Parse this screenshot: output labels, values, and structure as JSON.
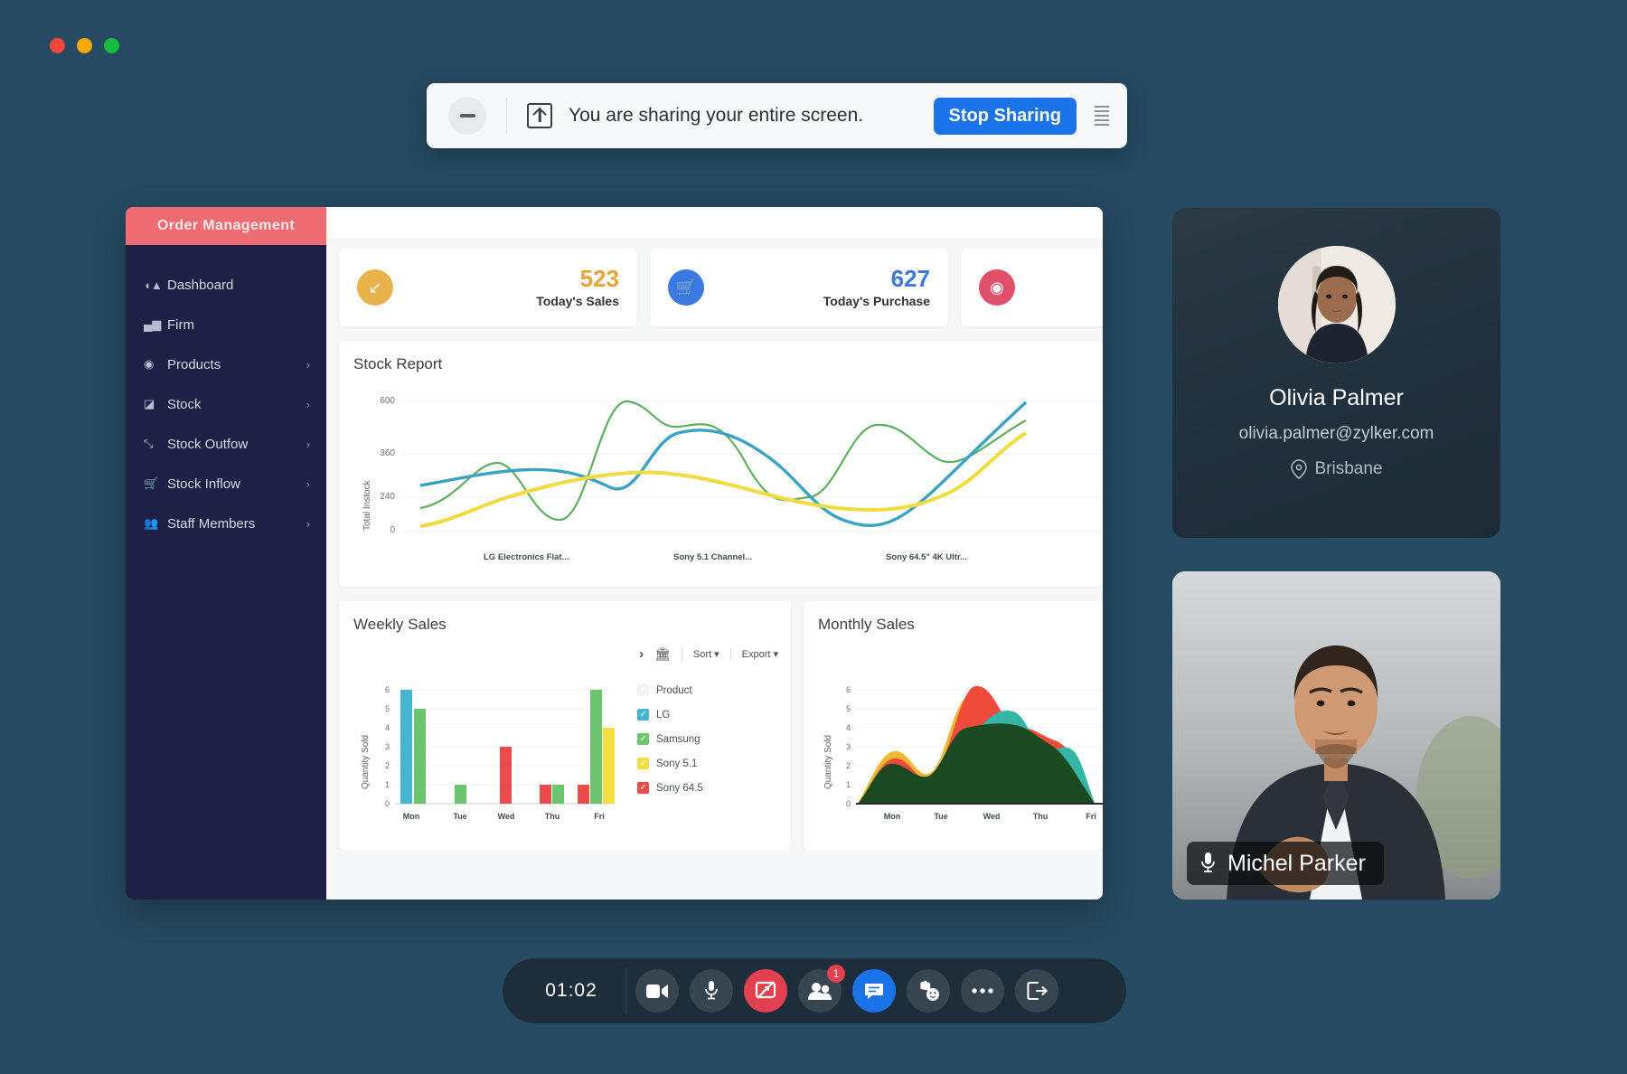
{
  "window_controls": {
    "close": "close",
    "minimize": "minimize",
    "zoom": "zoom"
  },
  "share_banner": {
    "minimize_label": "minimize-sharing-bar",
    "screen_icon": "screen-share-icon",
    "message": "You are sharing your entire screen.",
    "stop_label": "Stop Sharing",
    "menu_label": "more-options"
  },
  "dashboard": {
    "brand": "Order Management",
    "nav": [
      {
        "label": "Dashboard",
        "icon": "dashboard-icon",
        "chevron": ""
      },
      {
        "label": "Firm",
        "icon": "bar-chart-icon",
        "chevron": ""
      },
      {
        "label": "Products",
        "icon": "box-icon",
        "chevron": "›"
      },
      {
        "label": "Stock",
        "icon": "layers-icon",
        "chevron": "›"
      },
      {
        "label": "Stock Outfow",
        "icon": "trend-down-icon",
        "chevron": "›"
      },
      {
        "label": "Stock Inflow",
        "icon": "cart-icon",
        "chevron": "›"
      },
      {
        "label": "Staff Members",
        "icon": "users-icon",
        "chevron": "›"
      }
    ],
    "kpis": [
      {
        "value": "523",
        "label": "Today's Sales",
        "icon": "trend-icon",
        "color": "#e8b34a",
        "value_color": "#e8a23a"
      },
      {
        "value": "627",
        "label": "Today's Purchase",
        "icon": "cart-icon",
        "color": "#3b79e0",
        "value_color": "#3b79e0"
      },
      {
        "value": "",
        "label": "",
        "icon": "box-icon",
        "color": "#e0506a",
        "value_color": "#e0506a"
      }
    ],
    "stock_report": {
      "title": "Stock Report"
    },
    "weekly": {
      "title": "Weekly Sales",
      "tools": {
        "expand": "›",
        "chart_icon": "chart-icon",
        "sort": "Sort ▾",
        "export": "Export ▾"
      },
      "legend": [
        {
          "label": "Product",
          "color": "#f2f3f4"
        },
        {
          "label": "LG",
          "color": "#45b5d0"
        },
        {
          "label": "Samsung",
          "color": "#6cc46f"
        },
        {
          "label": "Sony 5.1",
          "color": "#f4dd41"
        },
        {
          "label": "Sony 64.5",
          "color": "#eb4b4b"
        }
      ]
    },
    "monthly": {
      "title": "Monthly Sales"
    }
  },
  "participants": [
    {
      "name": "Olivia Palmer",
      "email": "olivia.palmer@zylker.com",
      "location": "Brisbane",
      "location_icon": "map-pin-icon",
      "avatar": "avatar"
    },
    {
      "name": "Michel Parker",
      "mic_icon": "microphone-icon"
    }
  ],
  "toolbar": {
    "timer": "01:02",
    "buttons": [
      {
        "name": "video-button",
        "icon": "video-camera-icon",
        "state": "default",
        "badge": ""
      },
      {
        "name": "mic-button",
        "icon": "microphone-icon",
        "state": "default",
        "badge": ""
      },
      {
        "name": "screen-share-button",
        "icon": "screen-share-off-icon",
        "state": "active-red",
        "badge": ""
      },
      {
        "name": "participants-button",
        "icon": "people-icon",
        "state": "default",
        "badge": "1"
      },
      {
        "name": "chat-button",
        "icon": "chat-bubble-icon",
        "state": "active-blue",
        "badge": ""
      },
      {
        "name": "raise-hand-button",
        "icon": "raised-hand-icon",
        "state": "default",
        "badge": ""
      },
      {
        "name": "more-button",
        "icon": "ellipsis-icon",
        "state": "default",
        "badge": ""
      },
      {
        "name": "leave-button",
        "icon": "exit-icon",
        "state": "default",
        "badge": ""
      }
    ]
  },
  "chart_data": [
    {
      "type": "line",
      "title": "Stock Report",
      "xlabel": "",
      "ylabel": "Total Instock",
      "categories": [
        "LG Electronics Flat...",
        "Sony 5.1 Channel...",
        "Sony 64.5\" 4K Ultr..."
      ],
      "yticks": [
        0,
        240,
        360,
        600
      ],
      "ylim": [
        0,
        600
      ],
      "grid": true,
      "series": [
        {
          "name": "green",
          "color": "#5faf5f",
          "values": [
            215,
            300,
            560,
            230,
            520,
            440,
            390,
            500,
            330,
            500,
            420,
            520
          ]
        },
        {
          "name": "blue",
          "color": "#3aa3c4",
          "values": [
            275,
            300,
            310,
            295,
            250,
            360,
            375,
            350,
            300,
            230,
            235,
            560
          ]
        },
        {
          "name": "yellow",
          "color": "#f0dc3e",
          "values": [
            165,
            230,
            265,
            280,
            290,
            300,
            300,
            290,
            270,
            265,
            275,
            430
          ]
        }
      ]
    },
    {
      "type": "bar",
      "title": "Weekly Sales",
      "xlabel": "",
      "ylabel": "Quantity Sold",
      "categories": [
        "Mon",
        "Tue",
        "Wed",
        "Thu",
        "Fri"
      ],
      "yticks": [
        0,
        1,
        2,
        3,
        4,
        5,
        6
      ],
      "ylim": [
        0,
        6
      ],
      "grid": true,
      "series": [
        {
          "name": "LG",
          "color": "#45b5d0",
          "values": [
            6,
            0,
            0,
            0,
            0
          ]
        },
        {
          "name": "Samsung",
          "color": "#6cc46f",
          "values": [
            5,
            1,
            0,
            1,
            6
          ]
        },
        {
          "name": "Sony 5.1",
          "color": "#f4dd41",
          "values": [
            0,
            0,
            0,
            0,
            4
          ]
        },
        {
          "name": "Sony 64.5",
          "color": "#eb4b4b",
          "values": [
            0,
            0,
            3,
            1,
            1
          ]
        }
      ]
    },
    {
      "type": "area",
      "title": "Monthly Sales",
      "xlabel": "",
      "ylabel": "Quantity Sold",
      "categories": [
        "Mon",
        "Tue",
        "Wed",
        "Thu",
        "Fri"
      ],
      "yticks": [
        0,
        1,
        2,
        3,
        4,
        5,
        6
      ],
      "ylim": [
        0,
        6
      ],
      "grid": true,
      "stacked": true,
      "series": [
        {
          "name": "dark-green",
          "color": "#1b4a22",
          "values": [
            0.2,
            1.7,
            1.3,
            3.0,
            3.3,
            2.8,
            2.3,
            1.2,
            1.7,
            0.1
          ]
        },
        {
          "name": "teal",
          "color": "#35b5a6",
          "values": [
            0.0,
            0.0,
            0.0,
            0.0,
            1.3,
            0.6,
            0.4,
            0.9,
            0.0,
            0.0
          ]
        },
        {
          "name": "green",
          "color": "#4caf50",
          "values": [
            0.0,
            0.0,
            0.0,
            0.0,
            0.4,
            0.3,
            0.9,
            0.4,
            0.0,
            0.0
          ]
        },
        {
          "name": "red",
          "color": "#ee4b3c",
          "values": [
            0.3,
            1.2,
            0.4,
            2.7,
            0.6,
            0.9,
            0.4,
            0.2,
            0.1,
            0.0
          ]
        },
        {
          "name": "yellow",
          "color": "#f2b731",
          "values": [
            0.9,
            0.1,
            3.7,
            0.1,
            0.0,
            0.1,
            0.5,
            0.6,
            0.5,
            0.0
          ]
        }
      ]
    }
  ]
}
